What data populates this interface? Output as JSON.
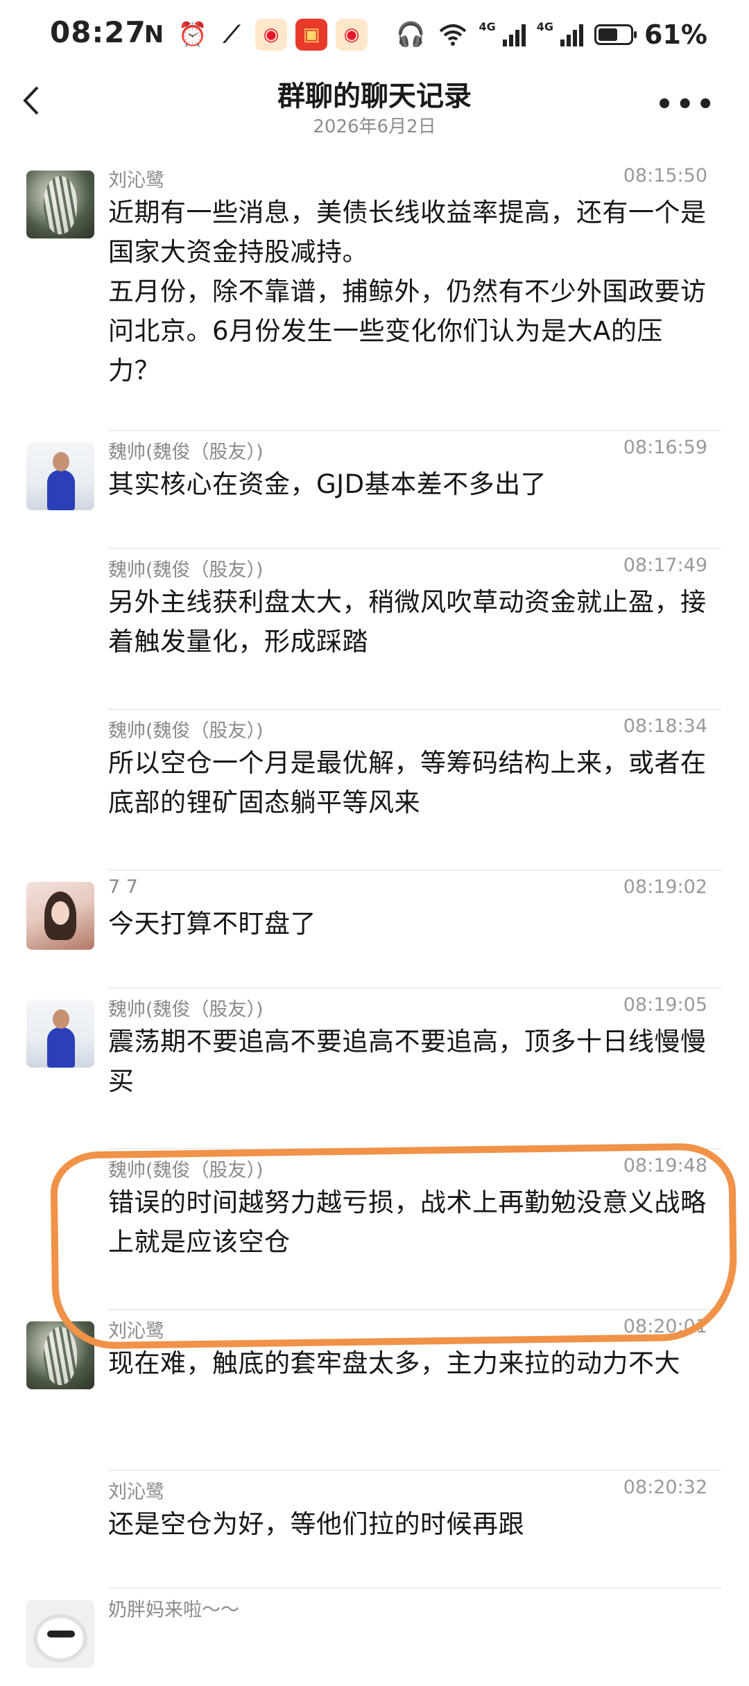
{
  "status_bar": {
    "time": "08:27",
    "battery": "61%",
    "battery_level": 0.61,
    "network_1": "4G",
    "network_2": "4G",
    "icons": [
      "nfc-icon",
      "alarm-icon",
      "link-icon",
      "weibo-app-icon",
      "red-app-icon",
      "weibo-app-icon",
      "headphones-icon",
      "wifi-icon",
      "signal-icon",
      "battery-icon"
    ]
  },
  "nav": {
    "title": "群聊的聊天记录",
    "subtitle": "2026年6月2日",
    "back_icon": "chevron-left-icon",
    "more_icon": "more-icon"
  },
  "messages": [
    {
      "sender": "刘沁鹭",
      "time": "08:15:50",
      "avatar": "liu",
      "lines": [
        "近期有一些消息，美债长线收益率提高，还有一个是国家大资金持股减持。",
        "五月份，除不靠谱，捕鲸外，仍然有不少外国政要访问北京。6月份发生一些变化你们认为是大A的压力？"
      ]
    },
    {
      "sender": "魏帅(魏俊（股友）)",
      "time": "08:16:59",
      "avatar": "wei",
      "lines": [
        "其实核心在资金，GJD基本差不多出了"
      ]
    },
    {
      "sender": "魏帅(魏俊（股友）)",
      "time": "08:17:49",
      "avatar": "",
      "lines": [
        "另外主线获利盘太大，稍微风吹草动资金就止盈，接着触发量化，形成踩踏"
      ]
    },
    {
      "sender": "魏帅(魏俊（股友）)",
      "time": "08:18:34",
      "avatar": "",
      "lines": [
        "所以空仓一个月是最优解，等筹码结构上来，或者在底部的锂矿固态躺平等风来"
      ]
    },
    {
      "sender": "7 7",
      "time": "08:19:02",
      "avatar": "77",
      "lines": [
        "今天打算不盯盘了"
      ]
    },
    {
      "sender": "魏帅(魏俊（股友）)",
      "time": "08:19:05",
      "avatar": "wei",
      "lines": [
        "震荡期不要追高不要追高不要追高，顶多十日线慢慢买"
      ]
    },
    {
      "sender": "魏帅(魏俊（股友）)",
      "time": "08:19:48",
      "avatar": "",
      "lines": [
        "错误的时间越努力越亏损，战术上再勤勉没意义战略上就是应该空仓"
      ]
    },
    {
      "sender": "刘沁鹭",
      "time": "08:20:01",
      "avatar": "liu",
      "lines": [
        "现在难，触底的套牢盘太多，主力来拉的动力不大"
      ]
    },
    {
      "sender": "刘沁鹭",
      "time": "08:20:32",
      "avatar": "",
      "lines": [
        "还是空仓为好，等他们拉的时候再跟"
      ]
    },
    {
      "sender": "奶胖妈来啦～～",
      "time": "",
      "avatar": "nai",
      "lines": [
        ""
      ]
    }
  ],
  "highlight_color": "#f09248"
}
